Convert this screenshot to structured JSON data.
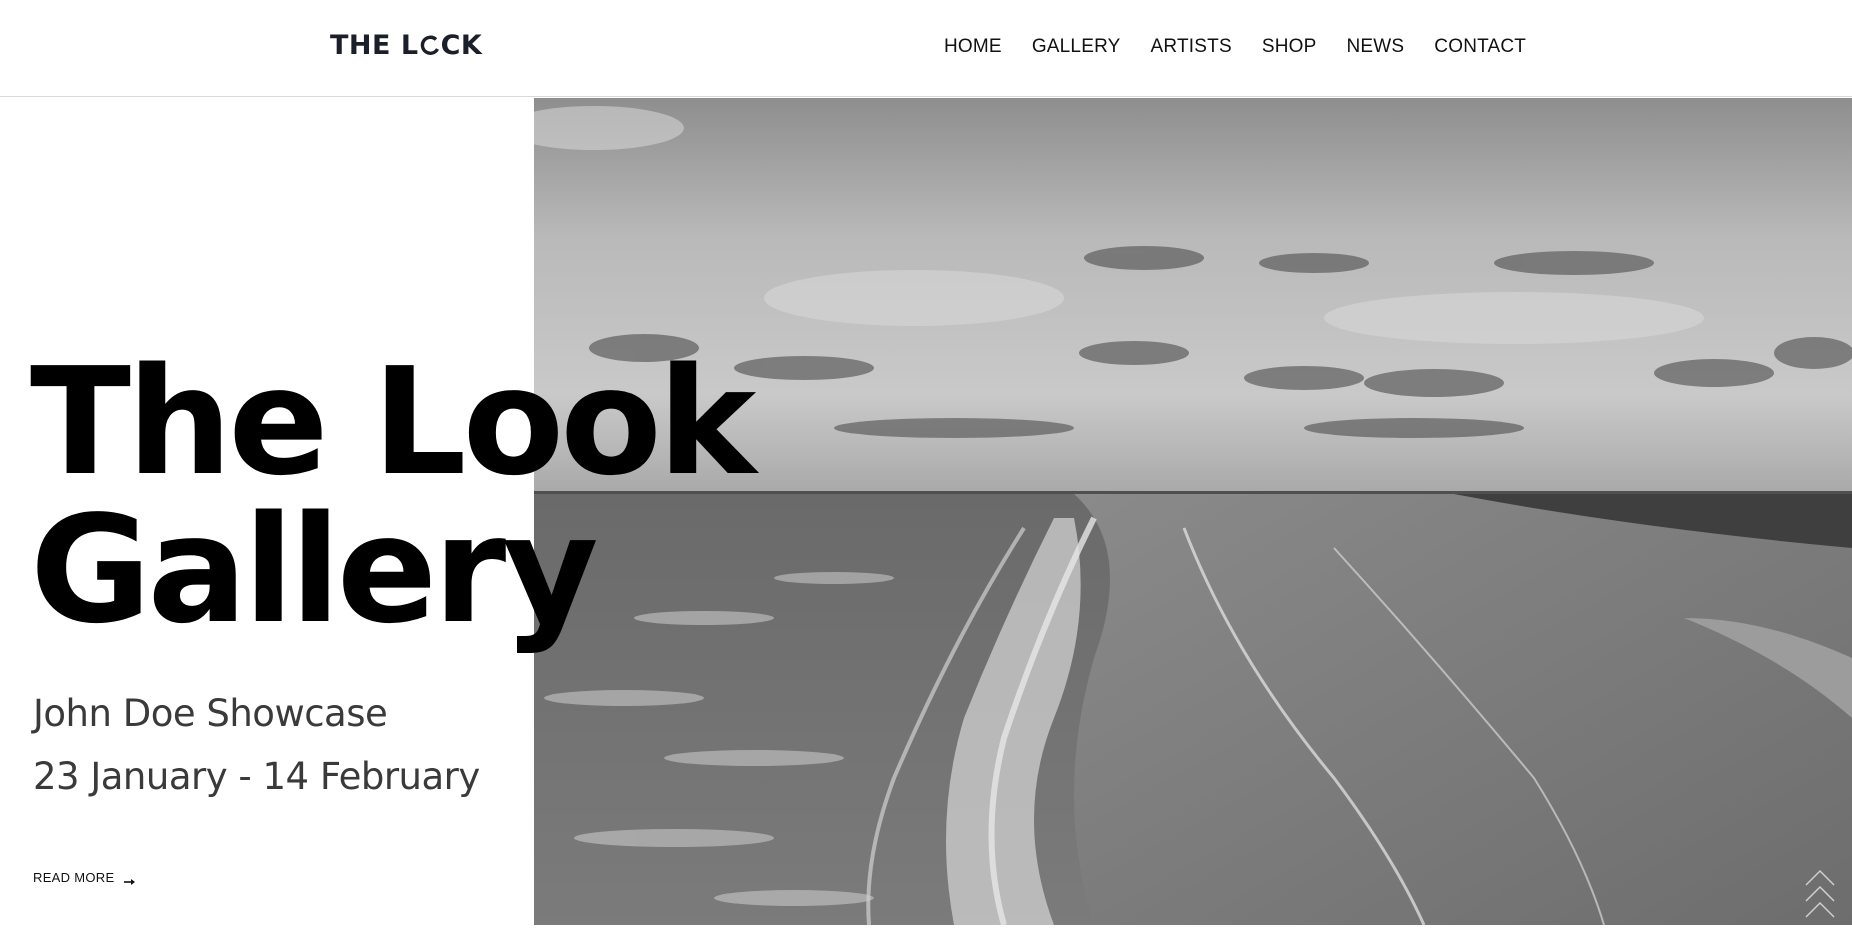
{
  "header": {
    "logo": {
      "text_left": "THE L",
      "text_right": "CK"
    },
    "nav": [
      {
        "label": "HOME"
      },
      {
        "label": "GALLERY"
      },
      {
        "label": "ARTISTS"
      },
      {
        "label": "SHOP"
      },
      {
        "label": "NEWS"
      },
      {
        "label": "CONTACT"
      }
    ]
  },
  "hero": {
    "title_line1": "The Look",
    "title_line2": "Gallery",
    "subtitle": "John Doe Showcase",
    "dates": "23 January - 14 February",
    "read_more_label": "READ MORE",
    "read_more_icon": "arrow-right-icon",
    "image": "black-and-white-beach-aerial-photo"
  },
  "scroll_top": {
    "icon": "chevron-up-icon"
  },
  "colors": {
    "text": "#111111",
    "logo": "#1b1f2a",
    "subtitle": "#3a3a3a",
    "divider": "#d9d9d9"
  }
}
